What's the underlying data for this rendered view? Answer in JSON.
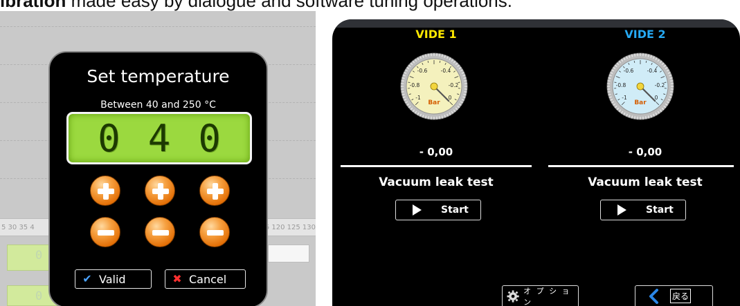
{
  "caption": {
    "bold": "ibration",
    "rest": " made easy by dialogue and software tuning operations."
  },
  "left": {
    "scale_left": "5  30  35  4",
    "scale_right": "5 120 125 130",
    "bg_digit": "0",
    "dialog": {
      "title": "Set temperature",
      "range": "Between 40 and 250 °C",
      "digits": [
        "0",
        "4",
        "0"
      ],
      "valid_label": "Valid",
      "cancel_label": "Cancel"
    }
  },
  "right": {
    "columns": [
      {
        "title": "VIDE 1",
        "title_color": "#ffe800",
        "gauge_face": "#f4f1bd",
        "value": "- 0,00",
        "test_label": "Vacuum leak test",
        "start_label": "Start"
      },
      {
        "title": "VIDE 2",
        "title_color": "#26a9f4",
        "gauge_face": "#d0ecf7",
        "value": "- 0,00",
        "test_label": "Vacuum leak test",
        "start_label": "Start"
      }
    ],
    "gauge": {
      "ticks": [
        "-0.6",
        "-0.4",
        "-0.8",
        "-0.2",
        "-1",
        "0"
      ],
      "unit": "Bar",
      "reading": 0.0
    },
    "options_label": "オ プ シ ョ ン",
    "back_label": "戻る"
  }
}
